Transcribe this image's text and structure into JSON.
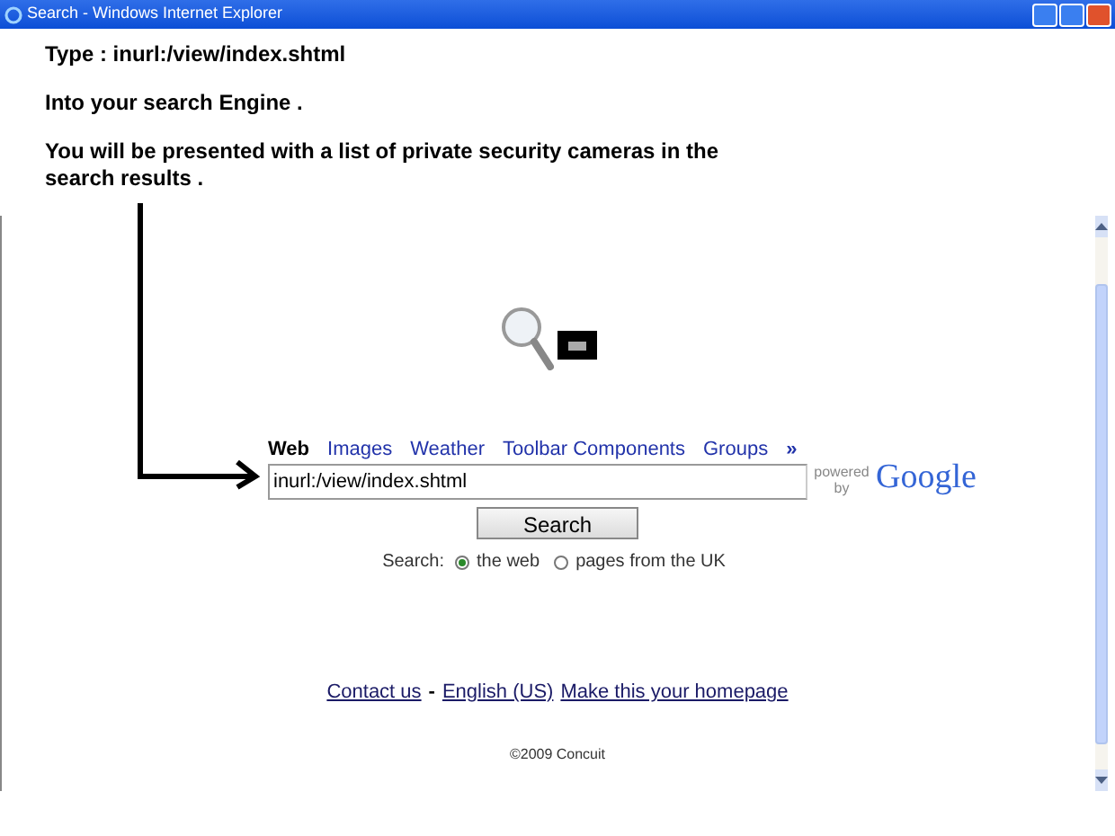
{
  "window": {
    "title": "Search - Windows Internet Explorer"
  },
  "instructions": [
    "Type : inurl:/view/index.shtml",
    "Into your search Engine .",
    "You will be presented with a list of private security cameras in the search results ."
  ],
  "tabs": [
    {
      "label": "Web",
      "selected": true
    },
    {
      "label": "Images",
      "selected": false
    },
    {
      "label": "Weather",
      "selected": false
    },
    {
      "label": "Toolbar Components",
      "selected": false
    },
    {
      "label": "Groups",
      "selected": false
    }
  ],
  "more_tabs": "»",
  "search": {
    "value": "inurl:/view/index.shtml",
    "button": "Search",
    "scope_label": "Search:",
    "scopes": [
      {
        "label": "the web",
        "selected": true
      },
      {
        "label": "pages from the UK",
        "selected": false
      }
    ]
  },
  "powered_by": {
    "text": "powered by",
    "brand": "Google"
  },
  "footer": {
    "links": [
      "Contact us",
      "English (US)",
      "Make this your homepage"
    ],
    "separator": "-",
    "copyright": "©2009 Concuit"
  }
}
